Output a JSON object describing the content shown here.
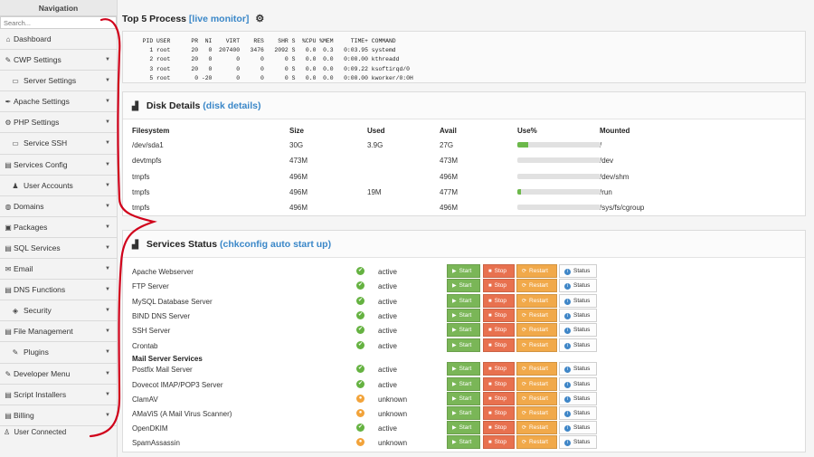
{
  "sidebar": {
    "title": "Navigation",
    "search_placeholder": "Search...",
    "items": [
      {
        "label": "Dashboard",
        "icon": "home-icon",
        "glyph": "⌂",
        "caret": false,
        "indent": false
      },
      {
        "label": "CWP Settings",
        "icon": "wrench-icon",
        "glyph": "✎",
        "caret": true,
        "indent": false
      },
      {
        "label": "Server Settings",
        "icon": "server-icon",
        "glyph": "▭",
        "caret": true,
        "indent": true
      },
      {
        "label": "Apache Settings",
        "icon": "feather-icon",
        "glyph": "✒",
        "caret": true,
        "indent": false
      },
      {
        "label": "PHP Settings",
        "icon": "gear-icon",
        "glyph": "⚙",
        "caret": true,
        "indent": false
      },
      {
        "label": "Service SSH",
        "icon": "terminal-icon",
        "glyph": "▭",
        "caret": true,
        "indent": true
      },
      {
        "label": "Services Config",
        "icon": "list-icon",
        "glyph": "▤",
        "caret": true,
        "indent": false
      },
      {
        "label": "User Accounts",
        "icon": "user-icon",
        "glyph": "♟",
        "caret": true,
        "indent": true
      },
      {
        "label": "Domains",
        "icon": "globe-icon",
        "glyph": "◍",
        "caret": true,
        "indent": false
      },
      {
        "label": "Packages",
        "icon": "package-icon",
        "glyph": "▣",
        "caret": true,
        "indent": false
      },
      {
        "label": "SQL Services",
        "icon": "database-icon",
        "glyph": "▤",
        "caret": true,
        "indent": false
      },
      {
        "label": "Email",
        "icon": "envelope-icon",
        "glyph": "✉",
        "caret": true,
        "indent": false
      },
      {
        "label": "DNS Functions",
        "icon": "dns-icon",
        "glyph": "▤",
        "caret": true,
        "indent": false
      },
      {
        "label": "Security",
        "icon": "shield-icon",
        "glyph": "◈",
        "caret": true,
        "indent": true
      },
      {
        "label": "File Management",
        "icon": "file-icon",
        "glyph": "▤",
        "caret": true,
        "indent": false
      },
      {
        "label": "Plugins",
        "icon": "plug-icon",
        "glyph": "✎",
        "caret": true,
        "indent": true
      },
      {
        "label": "Developer Menu",
        "icon": "code-icon",
        "glyph": "✎",
        "caret": true,
        "indent": false
      },
      {
        "label": "Script Installers",
        "icon": "script-icon",
        "glyph": "▤",
        "caret": true,
        "indent": false
      },
      {
        "label": "Billing",
        "icon": "billing-icon",
        "glyph": "▤",
        "caret": true,
        "indent": false
      }
    ],
    "status": {
      "label": "User Connected",
      "icon": "user-connected-icon",
      "glyph": "♙"
    }
  },
  "top_process": {
    "title": "Top 5 Process",
    "link": "[live monitor]",
    "header": "  PID USER      PR  NI    VIRT    RES    SHR S  %CPU %MEM     TIME+ COMMAND",
    "rows": [
      "    1 root      20   0  207400   3476   2092 S   0.0  0.3   0:03.95 systemd",
      "    2 root      20   0       0      0      0 S   0.0  0.0   0:00.00 kthreadd",
      "    3 root      20   0       0      0      0 S   0.0  0.0   0:09.22 ksoftirqd/0",
      "    5 root       0 -20       0      0      0 S   0.0  0.0   0:00.00 kworker/0:0H"
    ]
  },
  "disk": {
    "title": "Disk Details",
    "link": "(disk details)",
    "headers": {
      "fs": "Filesystem",
      "size": "Size",
      "used": "Used",
      "avail": "Avail",
      "usep": "Use%",
      "mounted": "Mounted"
    },
    "rows": [
      {
        "fs": "/dev/sda1",
        "size": "30G",
        "used": "3.9G",
        "avail": "27G",
        "use_fraction": 0.13,
        "mounted": "/"
      },
      {
        "fs": "devtmpfs",
        "size": "473M",
        "used": "",
        "avail": "473M",
        "use_fraction": 0.0,
        "mounted": "/dev"
      },
      {
        "fs": "tmpfs",
        "size": "496M",
        "used": "",
        "avail": "496M",
        "use_fraction": 0.0,
        "mounted": "/dev/shm"
      },
      {
        "fs": "tmpfs",
        "size": "496M",
        "used": "19M",
        "avail": "477M",
        "use_fraction": 0.04,
        "mounted": "/run"
      },
      {
        "fs": "tmpfs",
        "size": "496M",
        "used": "",
        "avail": "496M",
        "use_fraction": 0.0,
        "mounted": "/sys/fs/cgroup"
      }
    ]
  },
  "services": {
    "title": "Services Status",
    "link": "(chkconfig auto start up)",
    "buttons": {
      "start": "Start",
      "stop": "Stop",
      "restart": "Restart",
      "status": "Status"
    },
    "mail_header": "Mail Server Services",
    "rows": [
      {
        "name": "Apache Webserver",
        "status": "active",
        "ok": true
      },
      {
        "name": "FTP Server",
        "status": "active",
        "ok": true
      },
      {
        "name": "MySQL Database Server",
        "status": "active",
        "ok": true
      },
      {
        "name": "BIND DNS Server",
        "status": "active",
        "ok": true
      },
      {
        "name": "SSH Server",
        "status": "active",
        "ok": true
      },
      {
        "name": "Crontab",
        "status": "active",
        "ok": true
      }
    ],
    "mail_rows": [
      {
        "name": "Postfix Mail Server",
        "status": "active",
        "ok": true
      },
      {
        "name": "Dovecot IMAP/POP3 Server",
        "status": "active",
        "ok": true
      },
      {
        "name": "ClamAV",
        "status": "unknown",
        "ok": false
      },
      {
        "name": "AMaViS (A Mail Virus Scanner)",
        "status": "unknown",
        "ok": false
      },
      {
        "name": "OpenDKIM",
        "status": "active",
        "ok": true
      },
      {
        "name": "SpamAssassin",
        "status": "unknown",
        "ok": false
      }
    ]
  },
  "colors": {
    "link": "#3a87c8",
    "start": "#7ab657",
    "stop": "#e8714f",
    "restart": "#f1a94a",
    "annotation": "#d0021b"
  }
}
